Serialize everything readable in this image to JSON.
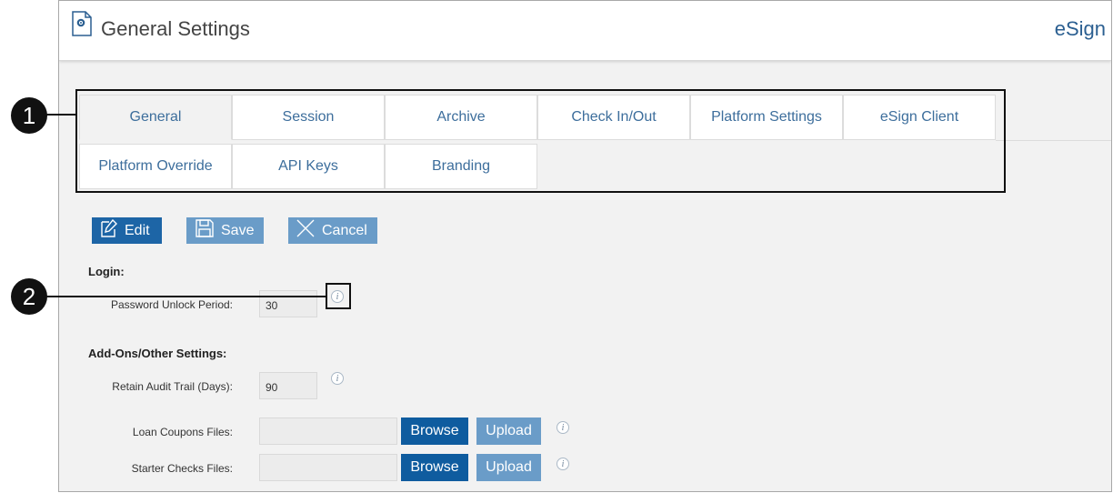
{
  "header": {
    "title": "General Settings",
    "brand": "eSign"
  },
  "tabs": [
    {
      "label": "General",
      "active": true
    },
    {
      "label": "Session",
      "active": false
    },
    {
      "label": "Archive",
      "active": false
    },
    {
      "label": "Check In/Out",
      "active": false
    },
    {
      "label": "Platform Settings",
      "active": false
    },
    {
      "label": "eSign Client",
      "active": false
    },
    {
      "label": "Platform Override",
      "active": false
    },
    {
      "label": "API Keys",
      "active": false
    },
    {
      "label": "Branding",
      "active": false
    }
  ],
  "toolbar": {
    "edit_label": "Edit",
    "save_label": "Save",
    "cancel_label": "Cancel"
  },
  "login": {
    "heading": "Login:",
    "password_unlock_label": "Password Unlock Period:",
    "password_unlock_value": "30"
  },
  "addons": {
    "heading": "Add-Ons/Other Settings:",
    "retain_audit_label": "Retain Audit Trail (Days):",
    "retain_audit_value": "90",
    "loan_coupons_label": "Loan Coupons Files:",
    "starter_checks_label": "Starter Checks Files:",
    "browse_label": "Browse",
    "upload_label": "Upload"
  },
  "callouts": {
    "one": "1",
    "two": "2"
  },
  "colors": {
    "primary_button": "#1d65a6",
    "secondary_button": "#6a9cc8",
    "tab_text": "#3d6e9c",
    "brand": "#2b5f91"
  },
  "icons": {
    "page": "settings-page-icon",
    "edit": "edit-icon",
    "save": "save-icon",
    "cancel": "cancel-icon",
    "info": "info-icon"
  }
}
